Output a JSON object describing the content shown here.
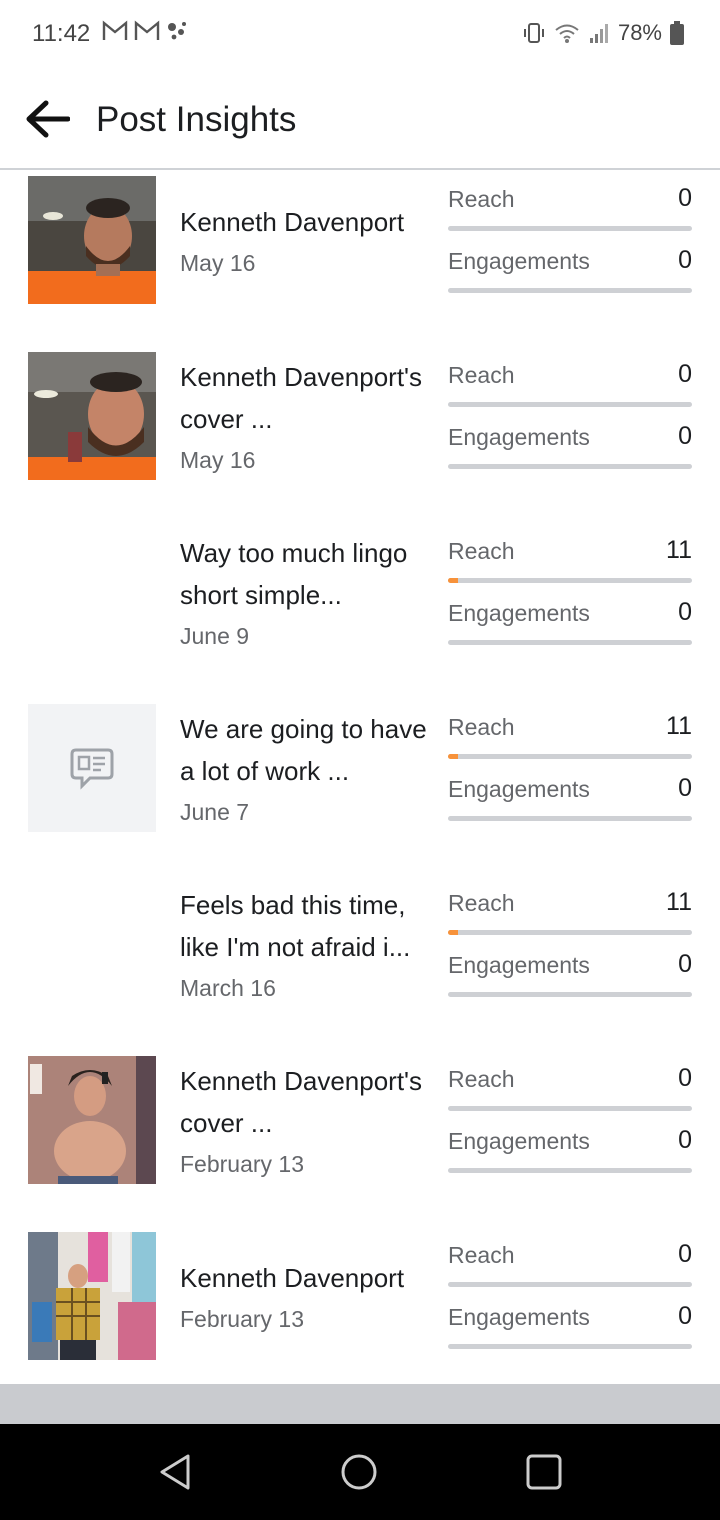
{
  "status_bar": {
    "time": "11:42",
    "battery": "78%",
    "left_icons": [
      "gmail-icon",
      "gmail-icon",
      "assistant-dots-icon"
    ],
    "right_icons": [
      "vibrate-icon",
      "wifi-icon",
      "signal-icon",
      "battery-icon"
    ]
  },
  "header": {
    "title": "Post Insights",
    "back_icon": "arrow-left-icon"
  },
  "posts": [
    {
      "title": "Kenneth Davenport",
      "date": "May 16",
      "thumb": "photo",
      "reach_label": "Reach",
      "reach": "0",
      "reach_fill": 0,
      "eng_label": "Engagements",
      "engagements": "0",
      "eng_fill": 0
    },
    {
      "title": "Kenneth Davenport's cover ...",
      "date": "May 16",
      "thumb": "photo",
      "reach_label": "Reach",
      "reach": "0",
      "reach_fill": 0,
      "eng_label": "Engagements",
      "engagements": "0",
      "eng_fill": 0
    },
    {
      "title": "Way too much lingo short simple...",
      "date": "June 9",
      "thumb": "none",
      "reach_label": "Reach",
      "reach": "11",
      "reach_fill": 0.04,
      "eng_label": "Engagements",
      "engagements": "0",
      "eng_fill": 0
    },
    {
      "title": "We are going to have a lot of work ...",
      "date": "June 7",
      "thumb": "status-icon",
      "reach_label": "Reach",
      "reach": "11",
      "reach_fill": 0.04,
      "eng_label": "Engagements",
      "engagements": "0",
      "eng_fill": 0
    },
    {
      "title": "Feels bad this time, like I'm not afraid i...",
      "date": "March 16",
      "thumb": "none",
      "reach_label": "Reach",
      "reach": "11",
      "reach_fill": 0.04,
      "eng_label": "Engagements",
      "engagements": "0",
      "eng_fill": 0
    },
    {
      "title": "Kenneth Davenport's cover ...",
      "date": "February 13",
      "thumb": "photo",
      "reach_label": "Reach",
      "reach": "0",
      "reach_fill": 0,
      "eng_label": "Engagements",
      "engagements": "0",
      "eng_fill": 0
    },
    {
      "title": "Kenneth Davenport",
      "date": "February 13",
      "thumb": "photo",
      "reach_label": "Reach",
      "reach": "0",
      "reach_fill": 0,
      "eng_label": "Engagements",
      "engagements": "0",
      "eng_fill": 0
    }
  ],
  "colors": {
    "accent": "#f7923a",
    "bar_track": "#ced0d4",
    "text_primary": "#1c1e21",
    "text_secondary": "#65676b"
  },
  "nav": {
    "icons": [
      "back-triangle-icon",
      "home-circle-icon",
      "recents-square-icon"
    ]
  }
}
